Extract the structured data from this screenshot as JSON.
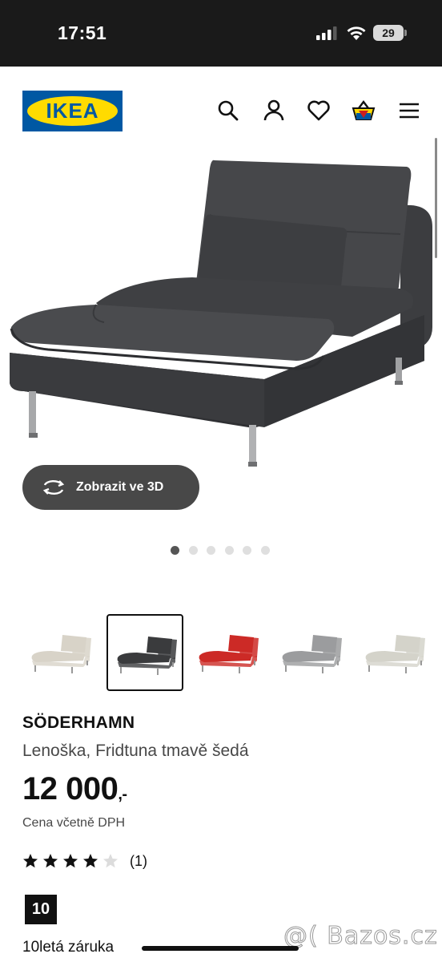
{
  "status_bar": {
    "time": "17:51",
    "battery": "29"
  },
  "header": {
    "logo": "IKEA",
    "icons": [
      "search-icon",
      "user-icon",
      "heart-icon",
      "basket-icon",
      "menu-icon"
    ]
  },
  "gallery": {
    "view_3d_label": "Zobrazit ve 3D",
    "dot_count": 6,
    "active_dot": 0
  },
  "variants": [
    {
      "color": "#d8d3c8",
      "selected": false
    },
    {
      "color": "#3a3b3d",
      "selected": true
    },
    {
      "color": "#cc2a26",
      "selected": false
    },
    {
      "color": "#9b9c9e",
      "selected": false
    },
    {
      "color": "#d4d3ca",
      "selected": false
    }
  ],
  "product": {
    "name": "SÖDERHAMN",
    "description": "Lenoška, Fridtuna tmavě šedá",
    "price": "12 000",
    "price_suffix": ",-",
    "vat_note": "Cena včetně DPH",
    "rating": 4,
    "rating_max": 5,
    "review_count": "(1)"
  },
  "warranty": {
    "years": "10",
    "label": "10letá záruka"
  },
  "watermark": "@( Bazos.cz",
  "colors": {
    "ikea_blue": "#0058a3",
    "ikea_yellow": "#ffdb00",
    "dark_button": "#484848"
  }
}
